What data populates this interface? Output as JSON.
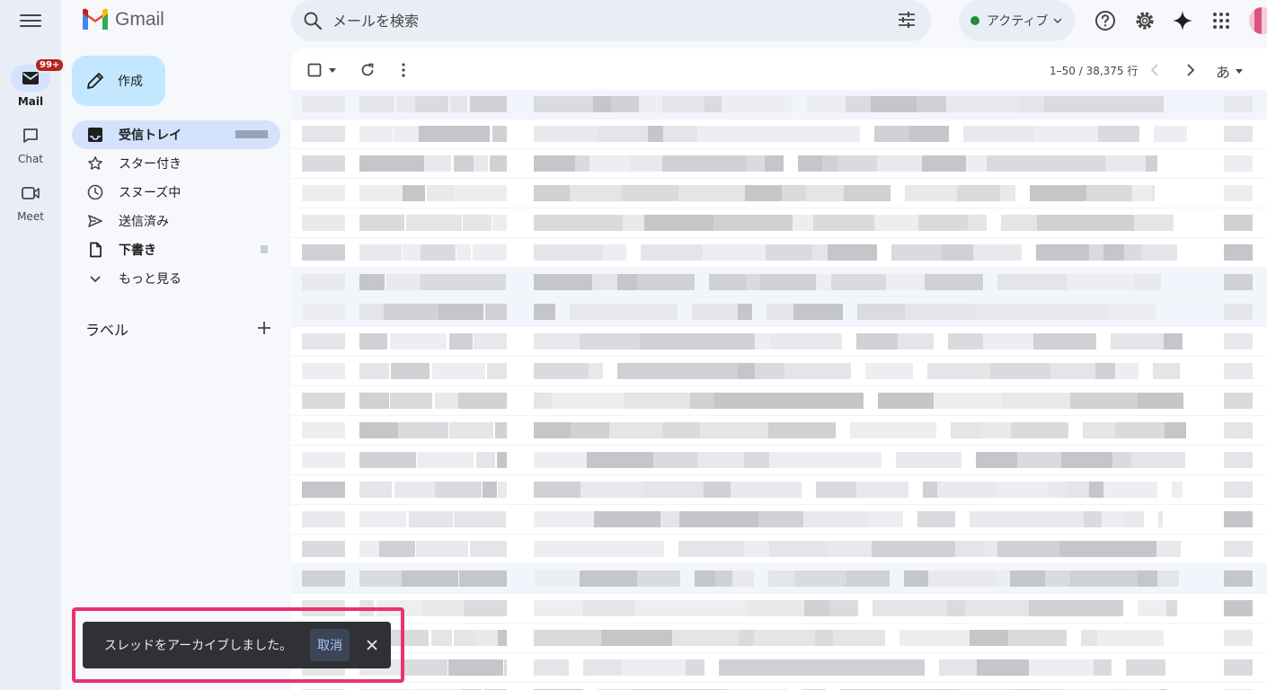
{
  "rail": {
    "mail": {
      "label": "Mail",
      "badge": "99+"
    },
    "chat": {
      "label": "Chat"
    },
    "meet": {
      "label": "Meet"
    }
  },
  "header": {
    "brand": "Gmail",
    "search_placeholder": "メールを検索",
    "status_label": "アクティブ"
  },
  "sidebar": {
    "compose_label": "作成",
    "items": [
      {
        "label": "受信トレイ",
        "icon": "inbox-icon"
      },
      {
        "label": "スター付き",
        "icon": "star-icon"
      },
      {
        "label": "スヌーズ中",
        "icon": "clock-icon"
      },
      {
        "label": "送信済み",
        "icon": "send-icon"
      },
      {
        "label": "下書き",
        "icon": "draft-icon"
      },
      {
        "label": "もっと見る",
        "icon": "chevron-down-icon"
      }
    ],
    "labels_heading": "ラベル"
  },
  "toolbar": {
    "pager": "1–50 / 38,375 行",
    "input_tool": "あ"
  },
  "snackbar": {
    "message": "スレッドをアーカイブしました。",
    "undo_label": "取消"
  },
  "colors": {
    "accent": "#0b57d0",
    "compose": "#c2e7ff",
    "active_nav": "#d3e3fd",
    "snackbar_bg": "#303134",
    "highlight": "#e8336f"
  }
}
